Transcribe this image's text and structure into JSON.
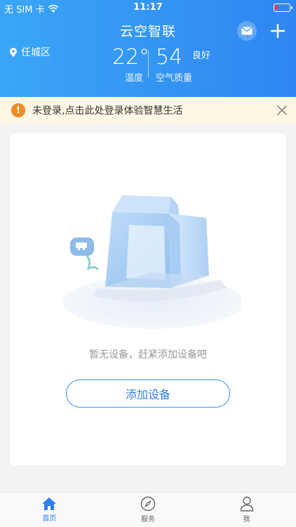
{
  "status_bar": {
    "carrier": "无 SIM 卡",
    "time": "11:17",
    "battery_level": 0.1
  },
  "header": {
    "title": "云空智联",
    "location": "任城区",
    "temperature": "22°",
    "temperature_label": "温度",
    "aqi": "54",
    "aqi_level": "良好",
    "aqi_label": "空气质量"
  },
  "login_banner": {
    "icon": "!",
    "text": "未登录,点击此处登录体验智慧生活"
  },
  "empty_state": {
    "message": "暂无设备，赶紧添加设备吧",
    "button_label": "添加设备"
  },
  "tabbar": {
    "items": [
      {
        "label": "首页",
        "icon": "home-icon",
        "active": true
      },
      {
        "label": "服务",
        "icon": "compass-icon",
        "active": false
      },
      {
        "label": "我",
        "icon": "user-icon",
        "active": false
      }
    ]
  },
  "colors": {
    "primary": "#2f7ff0",
    "header_gradient_start": "#3aa6f5",
    "warning": "#f08a24"
  }
}
